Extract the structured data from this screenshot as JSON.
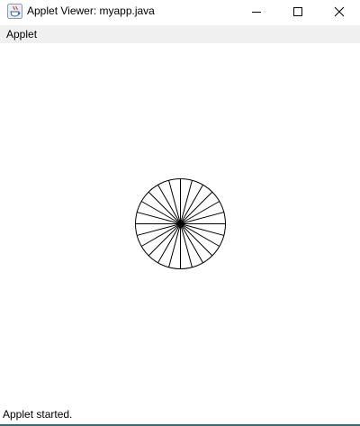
{
  "window": {
    "title": "Applet Viewer: myapp.java",
    "icon": "java-cup-icon",
    "controls": {
      "minimize": "minimize-icon",
      "maximize": "maximize-icon",
      "close": "close-icon"
    }
  },
  "menubar": {
    "items": [
      {
        "label": "Applet"
      }
    ]
  },
  "canvas": {
    "drawing": "circle-with-radial-spokes",
    "spoke_count": 24,
    "stroke_color": "#000000"
  },
  "status": {
    "text": "Applet started."
  }
}
